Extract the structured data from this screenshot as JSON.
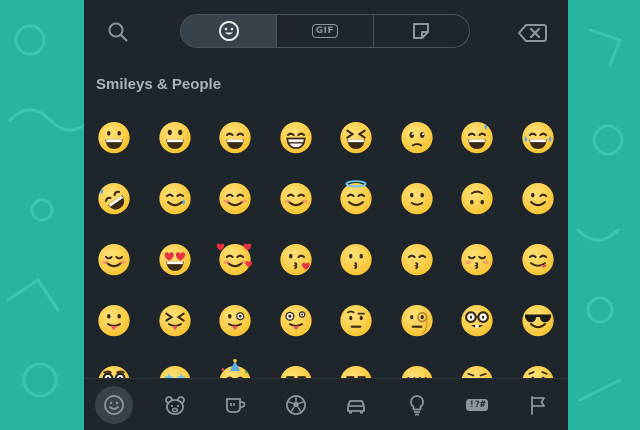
{
  "section_title": "Smileys & People",
  "top_tabs": [
    {
      "name": "emoji",
      "icon": "smiley-icon",
      "active": true
    },
    {
      "name": "gif",
      "label": "GIF",
      "icon": "gif-icon",
      "active": false
    },
    {
      "name": "stickers",
      "icon": "sticker-icon",
      "active": false
    }
  ],
  "top_bar": {
    "search_icon": "search-icon",
    "backspace_icon": "backspace-icon"
  },
  "emojis": [
    "grinning",
    "grinning-big-eyes",
    "grinning-smiling-eyes",
    "beaming",
    "squinting-laugh",
    "holding-back-tears",
    "grinning-sweat",
    "tears-of-joy",
    "rolling-on-floor-laughing",
    "smiling-with-tear",
    "smiling-blush",
    "smiling-blush",
    "smiling-halo",
    "slightly-smiling",
    "upside-down",
    "winking",
    "relieved",
    "heart-eyes",
    "smiling-hearts",
    "kissing-heart",
    "kissing",
    "kissing-smiling-eyes",
    "kissing-closed-eyes",
    "savoring-tongue",
    "tongue-out",
    "squinting-tongue",
    "winking-tongue",
    "zany",
    "raised-eyebrow",
    "monocle",
    "nerd",
    "sunglasses",
    "disguised",
    "star-struck",
    "partying",
    "smirking",
    "unamused",
    "disappointed",
    "pensive",
    "worried"
  ],
  "bottom_categories": [
    {
      "name": "smileys",
      "icon": "smiley-icon",
      "active": true
    },
    {
      "name": "animals",
      "icon": "bear-icon",
      "active": false
    },
    {
      "name": "food",
      "icon": "cup-icon",
      "active": false
    },
    {
      "name": "activity",
      "icon": "soccer-ball-icon",
      "active": false
    },
    {
      "name": "travel",
      "icon": "car-icon",
      "active": false
    },
    {
      "name": "objects",
      "icon": "lightbulb-icon",
      "active": false
    },
    {
      "name": "symbols",
      "label": "!?#",
      "icon": "symbols-icon",
      "active": false
    },
    {
      "name": "flags",
      "icon": "flag-icon",
      "active": false
    }
  ],
  "colors": {
    "background": "#27b5a0",
    "panel": "#1e262b",
    "icon": "#8d969c",
    "face": "#f7c22e"
  }
}
